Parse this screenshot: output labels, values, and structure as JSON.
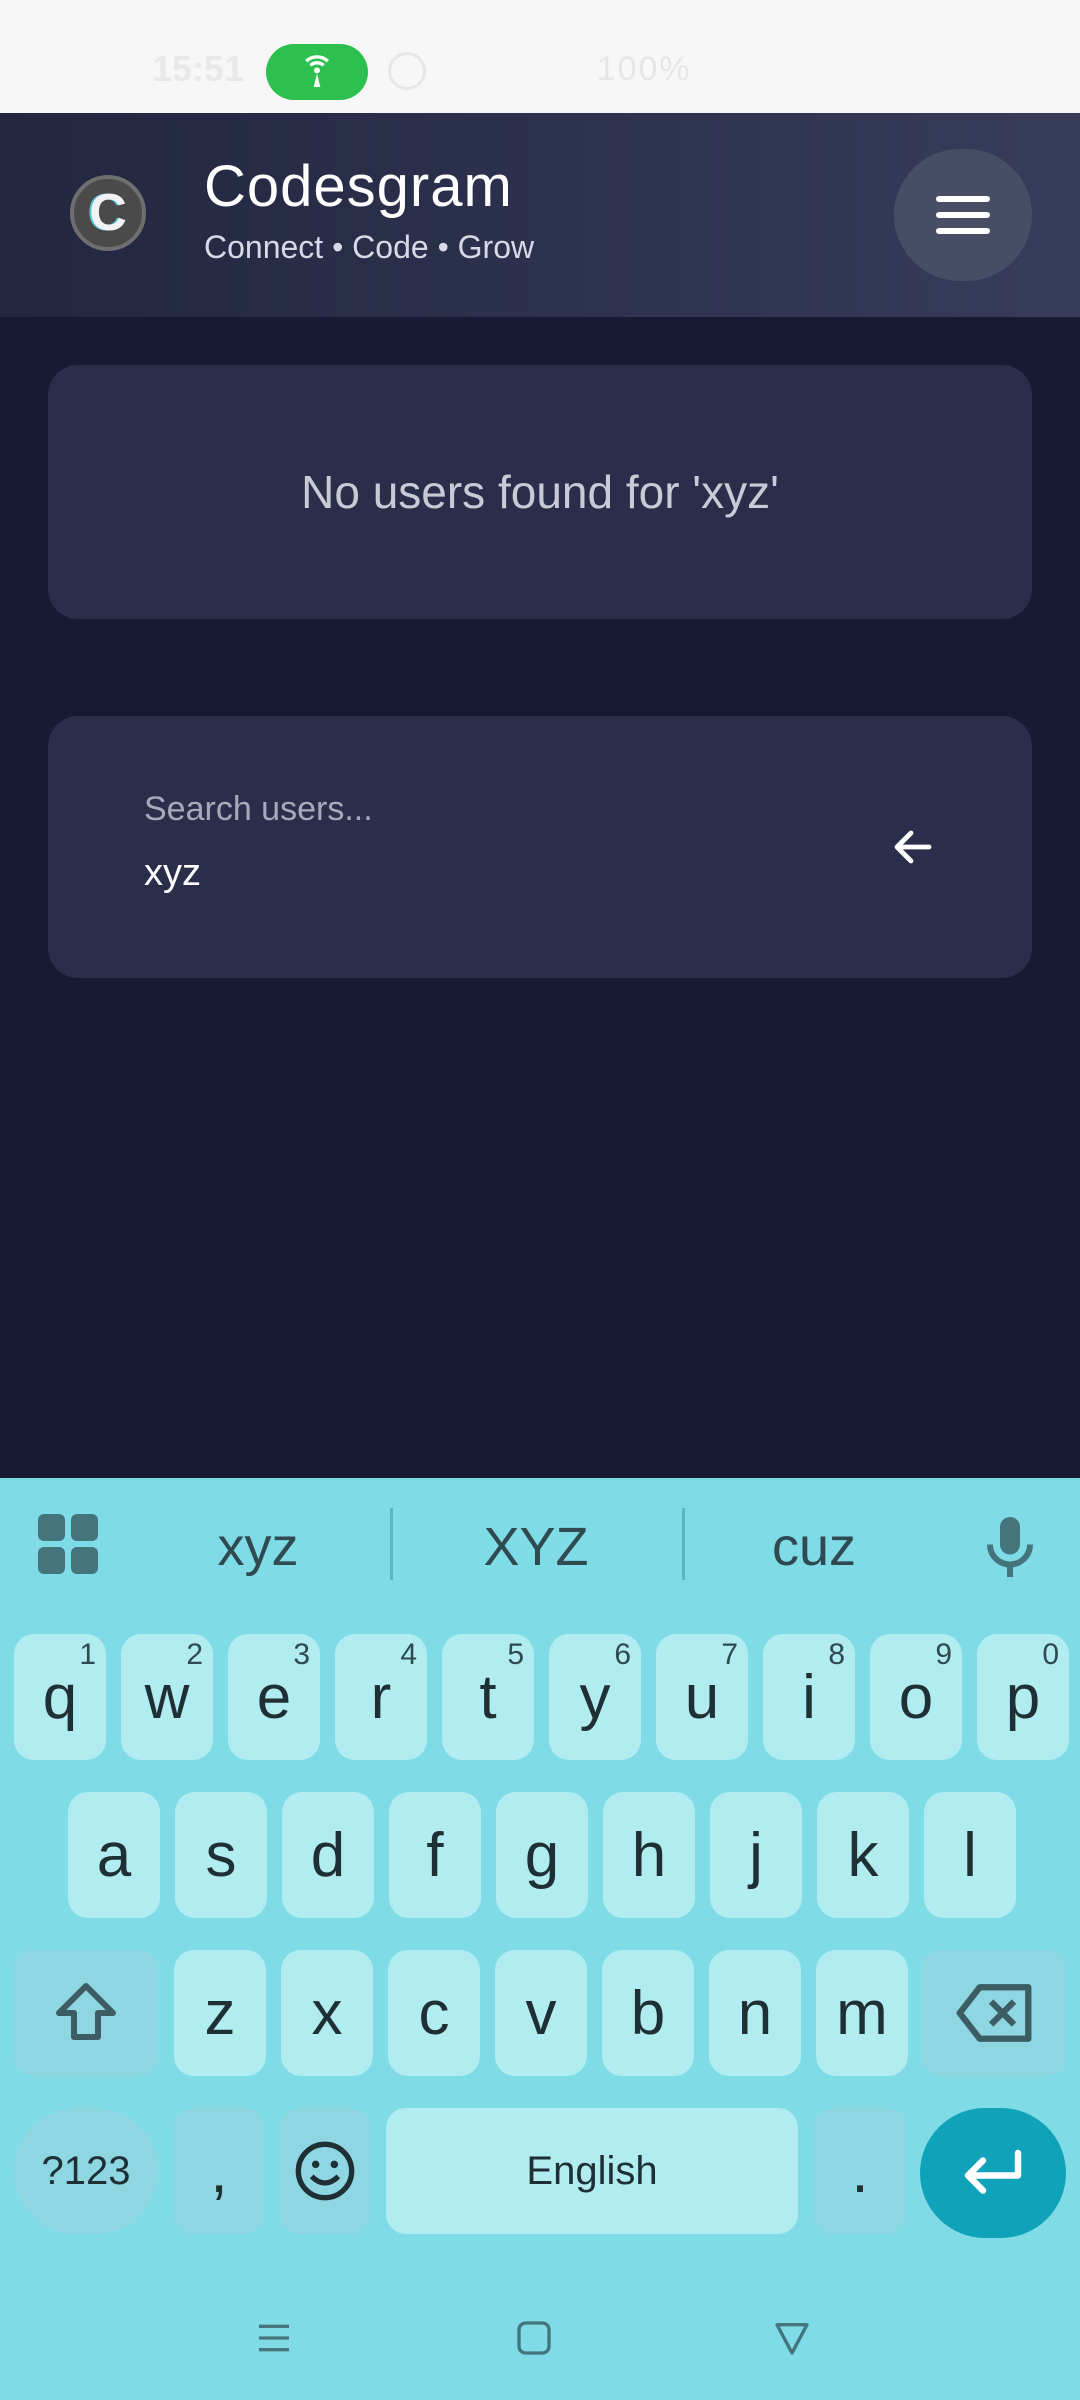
{
  "status_bar": {
    "time": "15:51",
    "right_text": "      100%"
  },
  "header": {
    "logo_letter": "C",
    "title": "Codesgram",
    "subtitle": "Connect • Code • Grow"
  },
  "results": {
    "message": "No users found for 'xyz'"
  },
  "search": {
    "label": "Search users...",
    "value": "xyz"
  },
  "keyboard": {
    "suggestions": [
      "xyz",
      "XYZ",
      "cuz"
    ],
    "row1": [
      {
        "k": "q",
        "n": "1"
      },
      {
        "k": "w",
        "n": "2"
      },
      {
        "k": "e",
        "n": "3"
      },
      {
        "k": "r",
        "n": "4"
      },
      {
        "k": "t",
        "n": "5"
      },
      {
        "k": "y",
        "n": "6"
      },
      {
        "k": "u",
        "n": "7"
      },
      {
        "k": "i",
        "n": "8"
      },
      {
        "k": "o",
        "n": "9"
      },
      {
        "k": "p",
        "n": "0"
      }
    ],
    "row2": [
      "a",
      "s",
      "d",
      "f",
      "g",
      "h",
      "j",
      "k",
      "l"
    ],
    "row3": [
      "z",
      "x",
      "c",
      "v",
      "b",
      "n",
      "m"
    ],
    "symbols_label": "?123",
    "comma": ",",
    "space_label": "English",
    "period": "."
  },
  "colors": {
    "background": "#161a33",
    "card": "#2b2e4b",
    "keyboard": "#7fdce7",
    "key": "#b1ecf1",
    "enter": "#0fa2b8",
    "hotspot": "#2ec04f"
  },
  "icons": {
    "menu": "hamburger-icon",
    "back": "arrow-left-icon",
    "hotspot": "wifi-hotspot-icon",
    "mic": "microphone-icon",
    "shift": "shift-icon",
    "backspace": "backspace-icon",
    "emoji": "emoji-icon",
    "enter": "enter-icon"
  }
}
